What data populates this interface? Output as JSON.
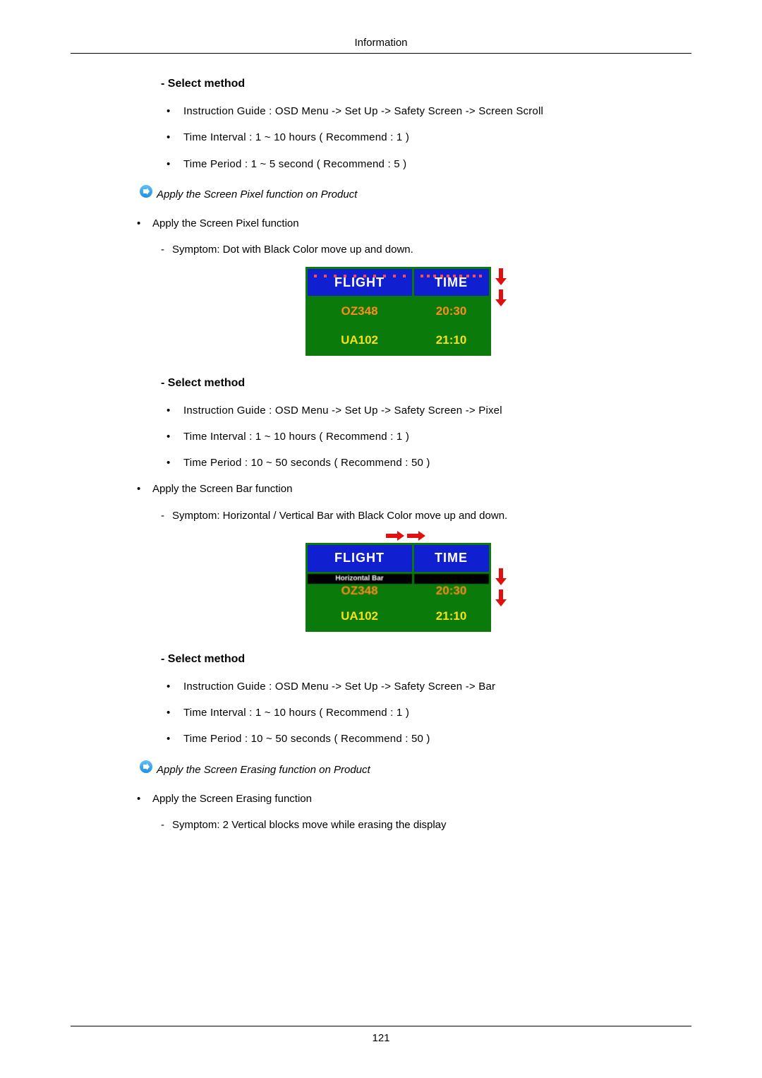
{
  "header": {
    "title": "Information"
  },
  "footer": {
    "page": "121"
  },
  "section1": {
    "heading": "Select method",
    "items": [
      "Instruction Guide : OSD Menu -> Set Up -> Safety Screen -> Screen Scroll",
      "Time Interval : 1 ~ 10 hours ( Recommend : 1 )",
      "Time Period : 1 ~ 5 second ( Recommend : 5 )"
    ]
  },
  "note1": "Apply the Screen Pixel function on Product",
  "pixel_block": {
    "apply": "Apply the Screen Pixel function",
    "symptom": "Symptom: Dot with Black Color move up and down."
  },
  "board1": {
    "head": [
      "FLIGHT",
      "TIME"
    ],
    "rows": [
      [
        "OZ348",
        "20:30"
      ],
      [
        "UA102",
        "21:10"
      ]
    ]
  },
  "section2": {
    "heading": "Select method",
    "items": [
      "Instruction Guide : OSD Menu -> Set Up -> Safety Screen -> Pixel",
      "Time Interval : 1 ~ 10 hours ( Recommend : 1 )",
      "Time Period : 10 ~ 50 seconds ( Recommend : 50 )"
    ]
  },
  "bar_block": {
    "apply": "Apply the Screen Bar function",
    "symptom": "Symptom: Horizontal / Vertical Bar with Black Color move up and down."
  },
  "board2": {
    "head": [
      "FLIGHT",
      "TIME"
    ],
    "hbar_label": "Horizontal Bar",
    "rows": [
      [
        "OZ348",
        "20:30"
      ],
      [
        "UA102",
        "21:10"
      ]
    ]
  },
  "section3": {
    "heading": "Select method",
    "items": [
      "Instruction Guide : OSD Menu -> Set Up -> Safety Screen -> Bar",
      "Time Interval : 1 ~ 10 hours ( Recommend : 1 )",
      "Time Period : 10 ~ 50 seconds ( Recommend : 50 )"
    ]
  },
  "note2": "Apply the Screen Erasing function on Product",
  "erase_block": {
    "apply": "Apply the Screen Erasing function",
    "symptom": "Symptom: 2 Vertical blocks move while erasing the display"
  }
}
